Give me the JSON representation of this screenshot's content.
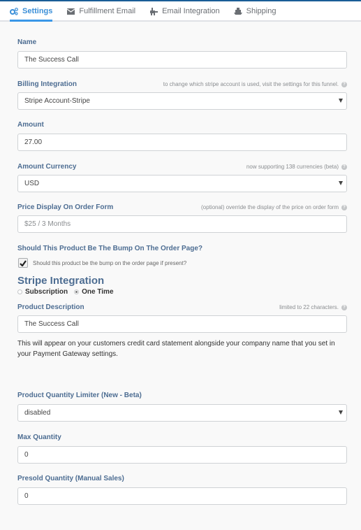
{
  "tabs": [
    {
      "label": "Settings",
      "icon": "gears-icon",
      "active": true
    },
    {
      "label": "Fulfillment Email",
      "icon": "envelope-icon",
      "active": false
    },
    {
      "label": "Email Integration",
      "icon": "plug-icon",
      "active": false
    },
    {
      "label": "Shipping",
      "icon": "ship-icon",
      "active": false
    }
  ],
  "form": {
    "name": {
      "label": "Name",
      "value": "The Success Call"
    },
    "billing": {
      "label": "Billing Integration",
      "hint": "to change which stripe account is used, visit the settings for this funnel.",
      "value": "Stripe Account-Stripe"
    },
    "amount": {
      "label": "Amount",
      "value": "27.00"
    },
    "currency": {
      "label": "Amount Currency",
      "hint": "now supporting 138 currencies (beta)",
      "value": "USD"
    },
    "price_display": {
      "label": "Price Display On Order Form",
      "hint": "(optional) override the display of the price on order form",
      "value": "",
      "placeholder": "$25 / 3 Months"
    },
    "bump": {
      "label": "Should This Product Be The Bump On The Order Page?",
      "checkbox_label": "Should this product be the bump on the order page if present?",
      "checked": true
    },
    "stripe": {
      "title": "Stripe Integration",
      "options": [
        {
          "label": "Subscription",
          "selected": false
        },
        {
          "label": "One Time",
          "selected": true
        }
      ]
    },
    "product_description": {
      "label": "Product Description",
      "hint": "limited to 22 characters.",
      "value": "The Success Call",
      "note": "This will appear on your customers credit card statement alongside your company name that you set in your Payment Gateway settings."
    },
    "quantity_limiter": {
      "label": "Product Quantity Limiter (New - Beta)",
      "value": "disabled"
    },
    "max_quantity": {
      "label": "Max Quantity",
      "value": "0"
    },
    "presold_quantity": {
      "label": "Presold Quantity (Manual Sales)",
      "value": "0"
    }
  },
  "colors": {
    "accent": "#3a97e8",
    "label": "#4d6d92",
    "top_border": "#1a5d96"
  }
}
